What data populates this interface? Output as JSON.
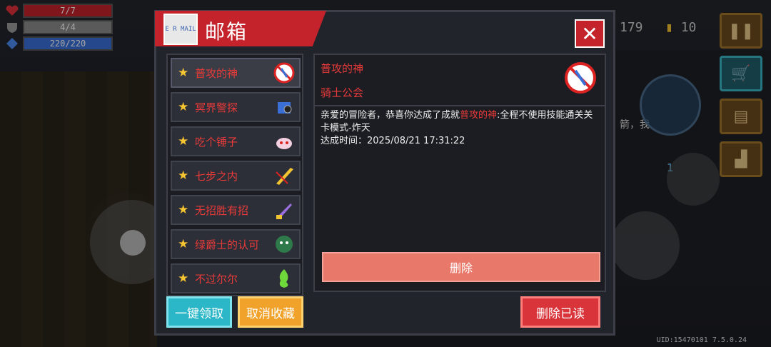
{
  "hud": {
    "hp": "7/7",
    "armor": "4/4",
    "energy": "220/220",
    "gems": "179",
    "coins": "10",
    "uid_version": "UID:15470101 7.5.0.24",
    "bg_text": "箭，我",
    "weapon_slot": "1"
  },
  "mailbox": {
    "title": "邮箱",
    "title_icon_text": "E R MAIL",
    "close_label": "✕",
    "items": [
      {
        "label": "普攻的神",
        "icon": "no-attack-icon"
      },
      {
        "label": "冥界警探",
        "icon": "detective-icon"
      },
      {
        "label": "吃个锤子",
        "icon": "hammer-icon"
      },
      {
        "label": "七步之内",
        "icon": "sword-icon"
      },
      {
        "label": "无招胜有招",
        "icon": "blade-icon"
      },
      {
        "label": "绿爵士的认可",
        "icon": "green-knight-icon"
      },
      {
        "label": "不过尔尔",
        "icon": "green-flame-icon"
      }
    ],
    "detail": {
      "title": "普攻的神",
      "sender": "骑士公会",
      "body_pre": "亲爱的冒险者，恭喜你达成了成就",
      "body_highlight": "普攻的神",
      "body_post": ":全程不使用技能通关关卡模式-炸天",
      "time": "达成时间：2025/08/21 17:31:22",
      "delete_label": "删除"
    },
    "buttons": {
      "claim_all": "一键领取",
      "unfavorite": "取消收藏",
      "delete_read": "删除已读"
    }
  },
  "colors": {
    "accent_red": "#c4232c",
    "text_red": "#e83a3a",
    "cyan": "#2bb7c7",
    "orange": "#f0a22a"
  }
}
